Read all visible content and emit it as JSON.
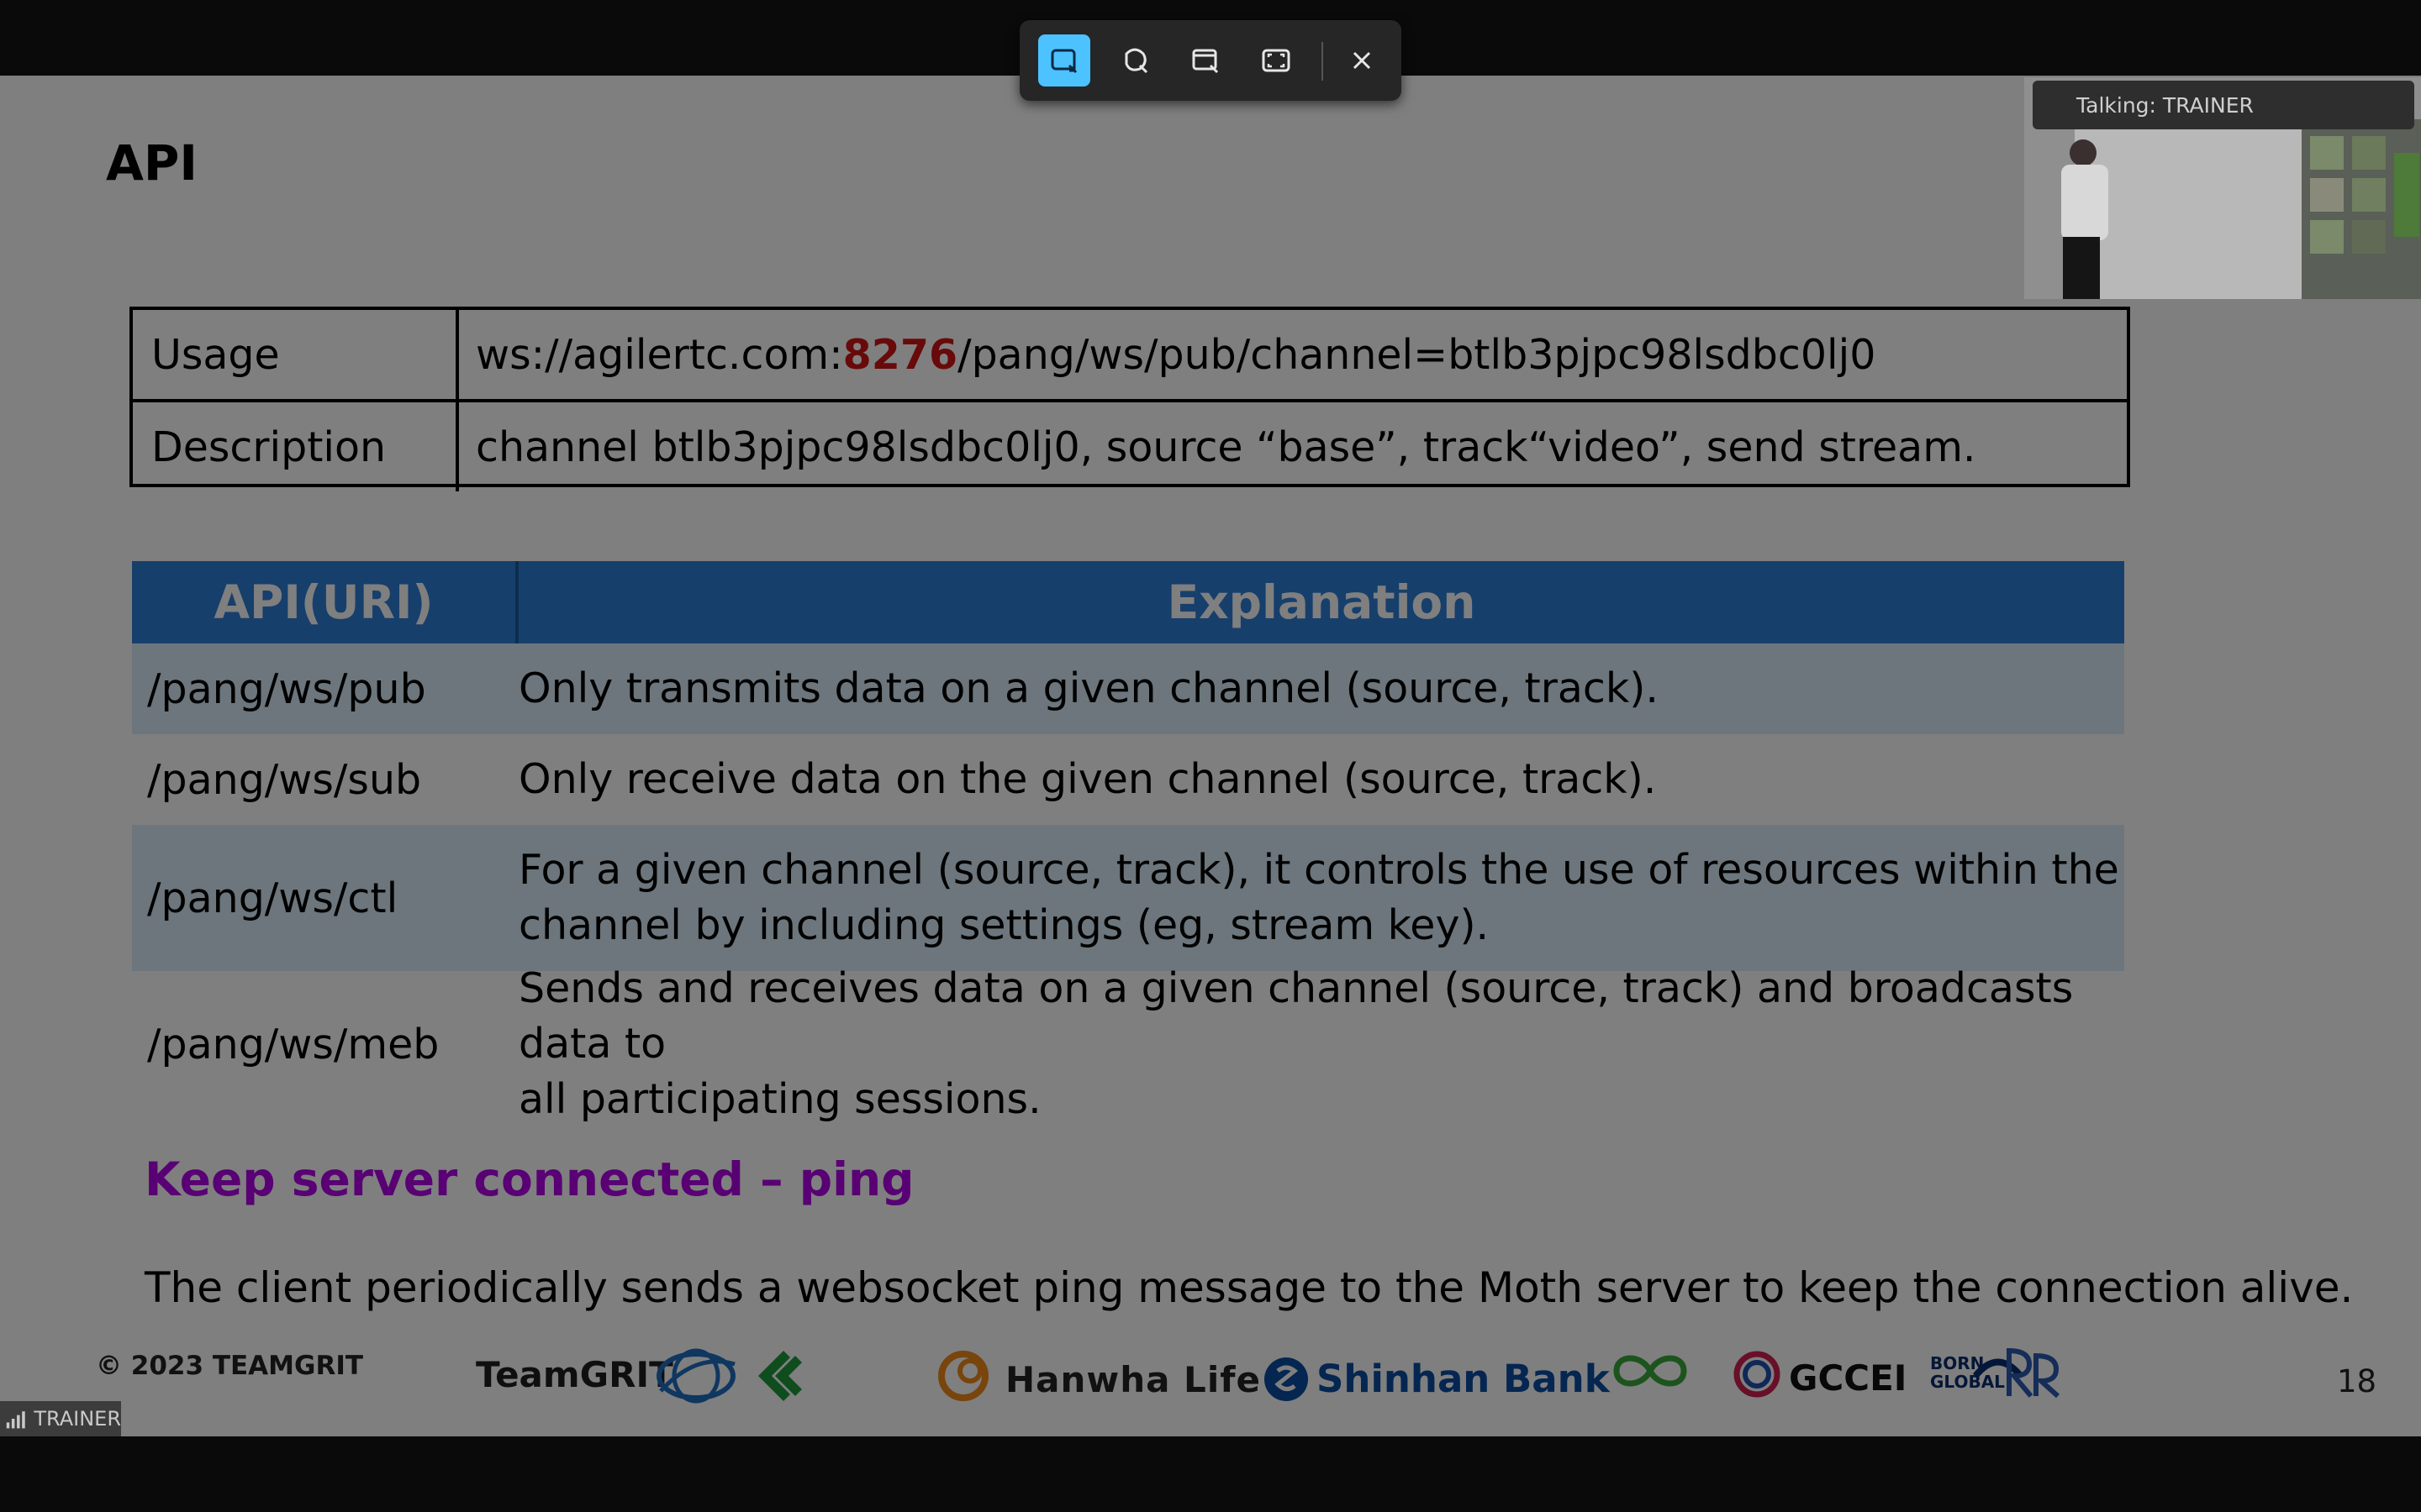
{
  "capture_toolbar": {
    "tools": [
      {
        "icon": "rectangle-snip-icon"
      },
      {
        "icon": "freeform-snip-icon"
      },
      {
        "icon": "window-snip-icon"
      },
      {
        "icon": "fullscreen-snip-icon"
      }
    ],
    "close_icon": "close-icon"
  },
  "video": {
    "talking": "Talking: TRAINER"
  },
  "slide": {
    "title": "API",
    "usage_table": [
      {
        "key": "Usage",
        "value_prefix": "ws://agilertc.com:",
        "value_port": "8276",
        "value_suffix": "/pang/ws/pub/channel=btlb3pjpc98lsdbc0lj0"
      },
      {
        "key": "Description",
        "value": "channel btlb3pjpc98lsdbc0lj0, source “base”, track“video”, send stream."
      }
    ],
    "api_table": {
      "headers": [
        "API(URI)",
        "Explanation"
      ],
      "rows": [
        {
          "uri": "/pang/ws/pub",
          "lines": [
            "Only transmits data on a given channel (source, track)."
          ]
        },
        {
          "uri": "/pang/ws/sub",
          "lines": [
            "Only receive data on the given channel (source, track)."
          ]
        },
        {
          "uri": "/pang/ws/ctl",
          "lines": [
            "For a given channel (source, track), it controls the use of resources within the",
            "channel by including settings (eg, stream key)."
          ]
        },
        {
          "uri": "/pang/ws/meb",
          "lines": [
            "Sends and receives data on a given channel (source, track) and broadcasts data to",
            "all participating sessions."
          ]
        }
      ]
    },
    "subheading": "Keep server connected – ping",
    "paragraph": "The client periodically sends a websocket ping message to the Moth server to keep the connection alive.",
    "footer": {
      "copyright": "© 2023 TEAMGRIT",
      "page_number": "18",
      "logos": {
        "teamgrit": "TeamGRIT",
        "hanwha": "Hanwha Life",
        "shinhan": "Shinhan Bank",
        "gccei": "GCCEI",
        "bornglobal_1": "BORN",
        "bornglobal_2": "GLOBAL"
      }
    }
  },
  "speaker_tag": {
    "label": "TRAINER",
    "icon": "signal-bars-icon"
  },
  "colors": {
    "accent_blue": "#2e7fd8",
    "port_red": "#d01515",
    "subheading_purple": "#b000e8",
    "toolbar_active": "#4cc2ff"
  }
}
